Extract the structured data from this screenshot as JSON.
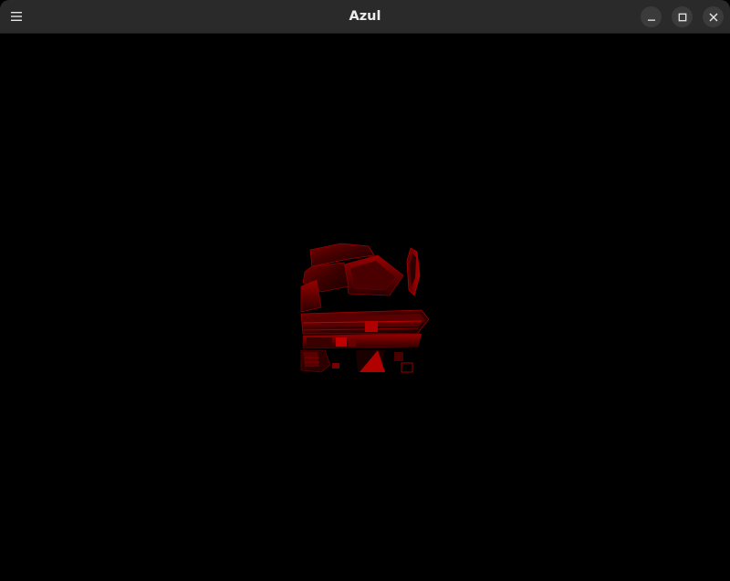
{
  "window": {
    "title": "Azul"
  },
  "titlebar": {
    "menu_icon": "hamburger-menu-icon",
    "minimize_icon": "minimize-icon",
    "maximize_icon": "maximize-icon",
    "close_icon": "close-icon"
  },
  "viewport": {
    "background": "#000000",
    "model_color": "#b00000"
  }
}
